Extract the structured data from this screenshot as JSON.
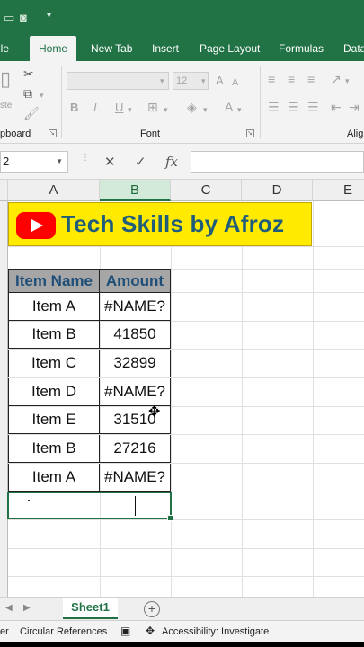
{
  "ribbon": {
    "tabs": [
      {
        "label": "ile",
        "active": false
      },
      {
        "label": "Home",
        "active": true
      },
      {
        "label": "New Tab",
        "active": false
      },
      {
        "label": "Insert",
        "active": false
      },
      {
        "label": "Page Layout",
        "active": false
      },
      {
        "label": "Formulas",
        "active": false
      },
      {
        "label": "Data",
        "active": false
      }
    ],
    "clipboard_label": "pboard",
    "font_label": "Font",
    "alignment_label": "Alig",
    "font_size": "12",
    "paste_label": "ste",
    "bold": "B",
    "italic": "I",
    "underline": "U"
  },
  "formula_bar": {
    "name_box": "2",
    "cancel": "✕",
    "enter": "✓",
    "fx": "fx",
    "value": ""
  },
  "grid": {
    "columns": [
      "A",
      "B",
      "C",
      "D",
      "E"
    ],
    "selected_column": "B",
    "banner_text": "Tech Skills by Afroz",
    "table_headers": [
      "Item Name",
      "Amount"
    ],
    "rows": [
      {
        "item": "Item A",
        "amount": "#NAME?"
      },
      {
        "item": "Item B",
        "amount": "41850"
      },
      {
        "item": "Item C",
        "amount": "32899"
      },
      {
        "item": "Item D",
        "amount": "#NAME?"
      },
      {
        "item": "Item E",
        "amount": "31510"
      },
      {
        "item": "Item B",
        "amount": "27216"
      },
      {
        "item": "Item A",
        "amount": "#NAME?"
      }
    ]
  },
  "sheets": {
    "tabs": [
      "Sheet1"
    ],
    "add": "+"
  },
  "status_bar": {
    "mode": "er",
    "circular": "Circular References",
    "accessibility": "Accessibility: Investigate"
  },
  "colors": {
    "excel_green": "#217346",
    "banner_yellow": "#ffea00",
    "banner_text": "#1f5d7a",
    "header_fill": "#a6a6a6",
    "header_text": "#1f4e79",
    "youtube_red": "#ff0000"
  }
}
